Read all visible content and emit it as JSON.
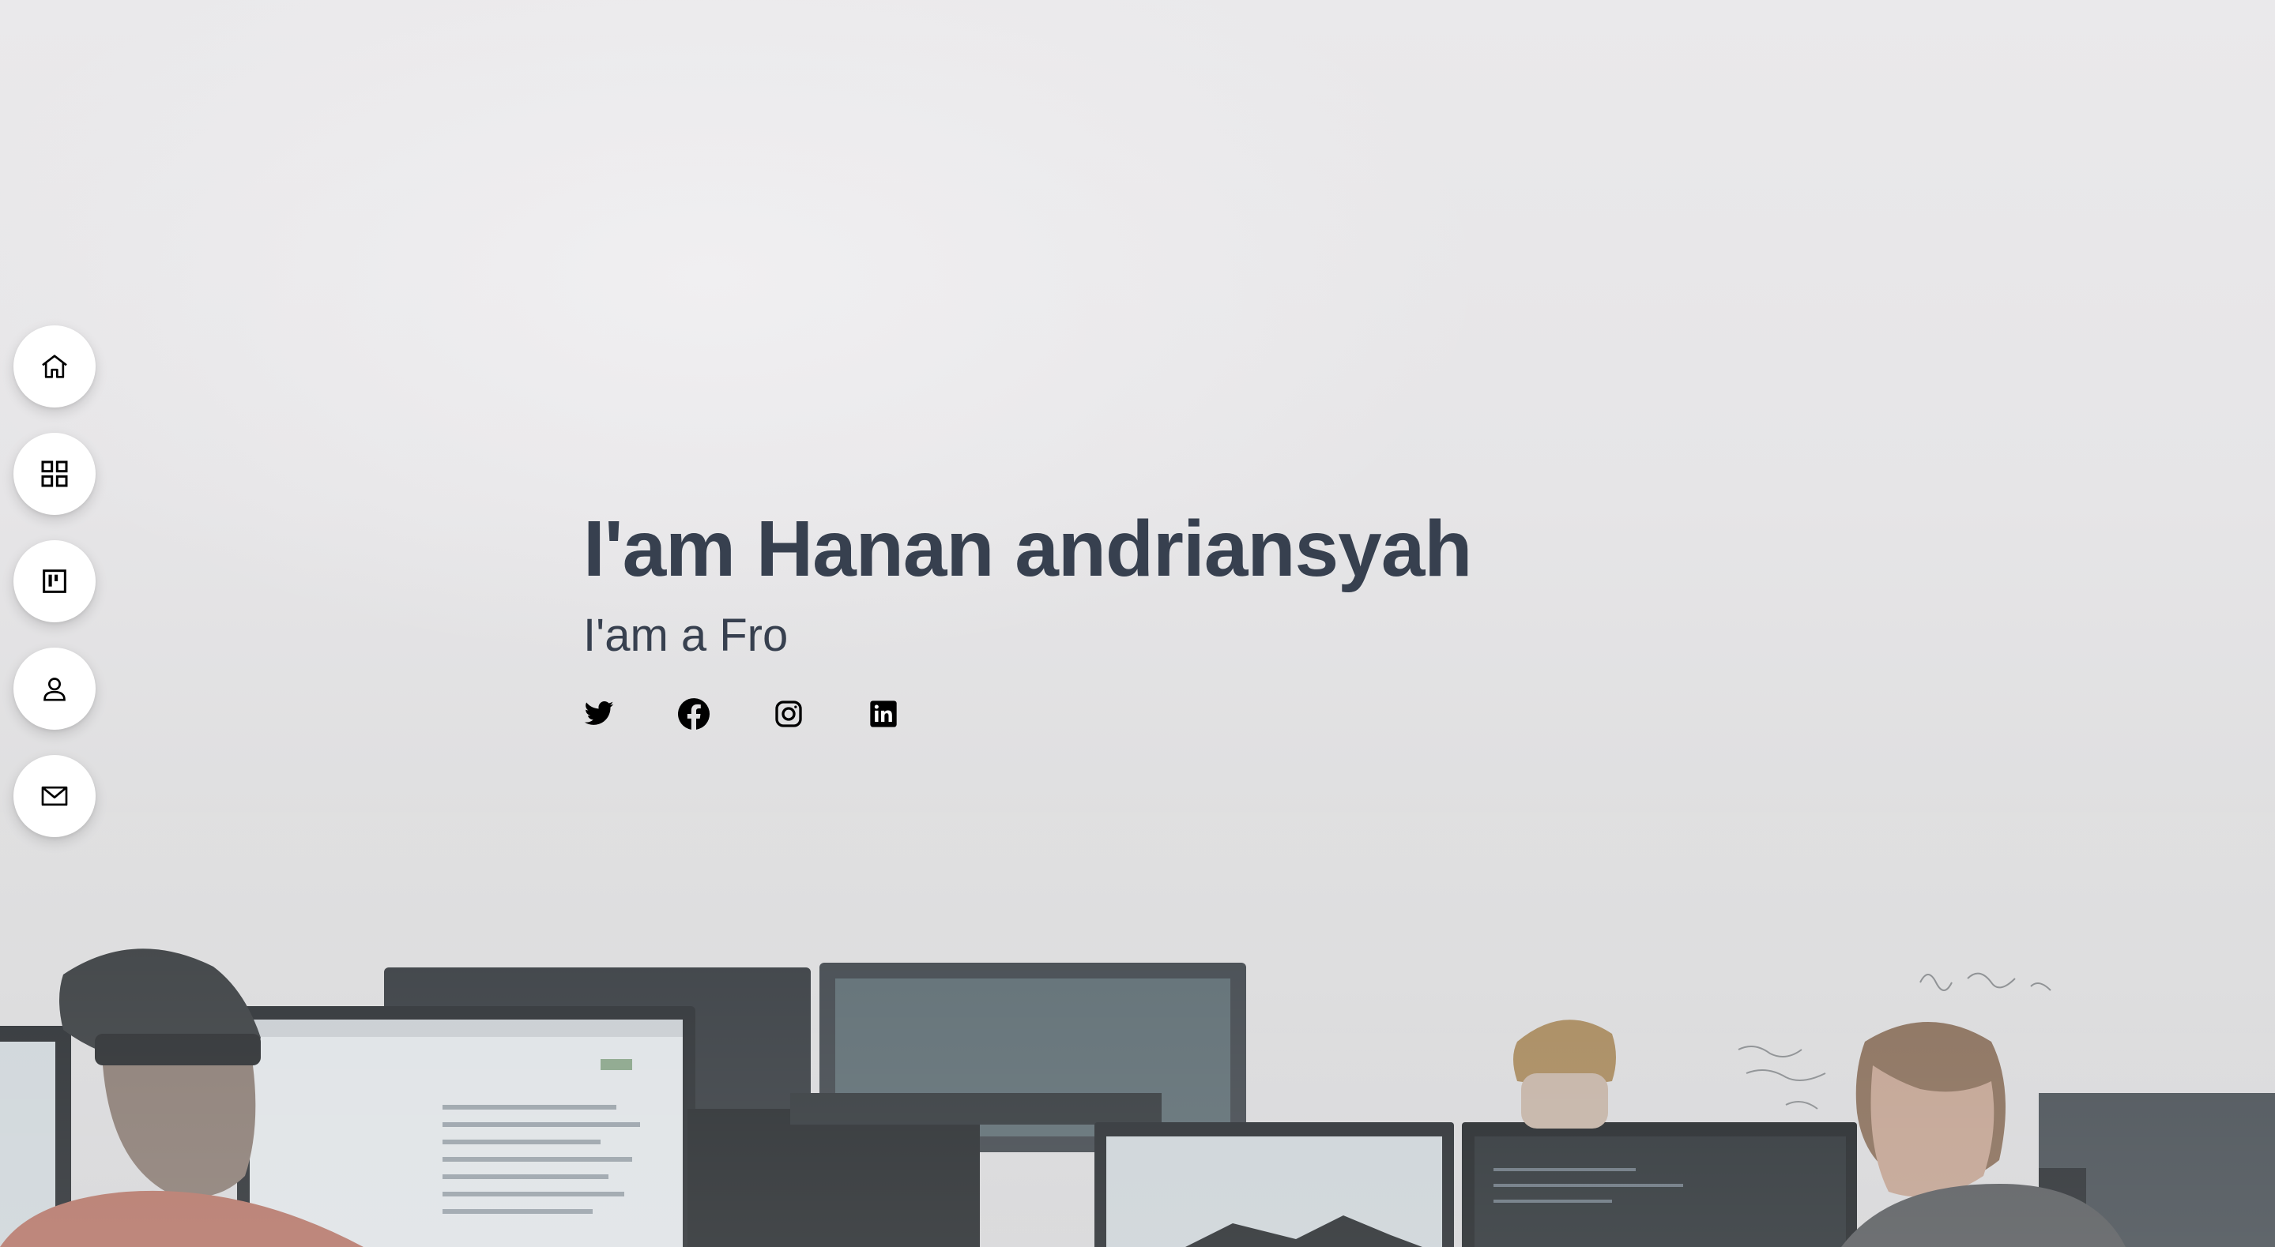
{
  "hero": {
    "title": "I'am Hanan andriansyah",
    "subtitle": "I'am a Fro"
  },
  "nav": [
    {
      "icon": "home-icon"
    },
    {
      "icon": "grid-icon"
    },
    {
      "icon": "portfolio-icon"
    },
    {
      "icon": "user-icon"
    },
    {
      "icon": "mail-icon"
    }
  ],
  "socials": [
    {
      "icon": "twitter-icon"
    },
    {
      "icon": "facebook-icon"
    },
    {
      "icon": "instagram-icon"
    },
    {
      "icon": "linkedin-icon"
    }
  ],
  "colors": {
    "heading": "#37404f",
    "nav_bg": "#ffffff",
    "icon": "#000000"
  }
}
